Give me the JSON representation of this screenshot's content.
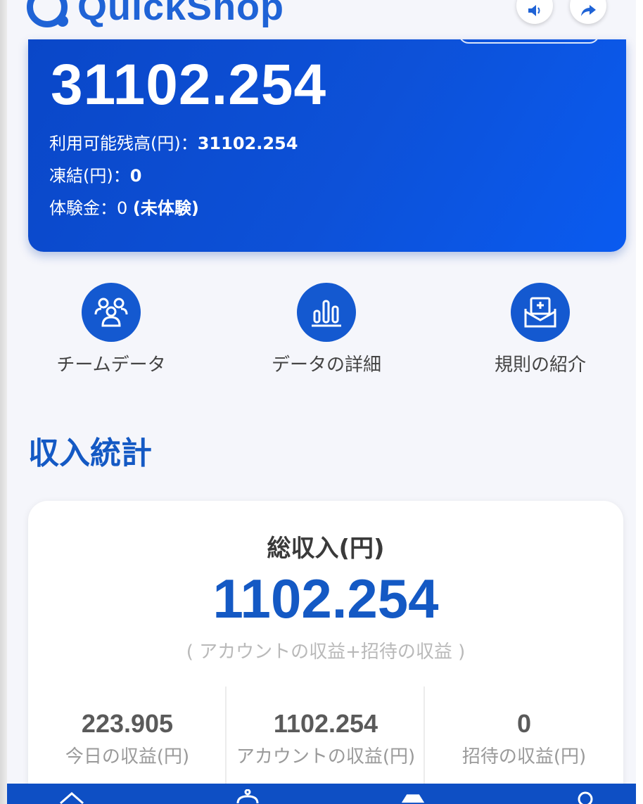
{
  "header": {
    "logo_text": "QuickShop",
    "sound_icon": "speaker-icon",
    "share_icon": "share-icon"
  },
  "balance": {
    "amount": "31102.254",
    "available_label": "利用可能残高(円)：",
    "available_value": "31102.254",
    "frozen_label": "凍結(円)：",
    "frozen_value": "0",
    "trial_label": "体験金：0 ",
    "trial_value": "(未体験)"
  },
  "actions": [
    {
      "label": "チームデータ",
      "icon": "team-icon"
    },
    {
      "label": "データの詳細",
      "icon": "bar-chart-icon"
    },
    {
      "label": "規則の紹介",
      "icon": "rules-envelope-icon"
    }
  ],
  "income": {
    "section_title": "収入統計",
    "total_label": "総収入(円)",
    "total_value": "1102.254",
    "total_note": "( アカウントの収益+招待の収益 )",
    "stats": [
      {
        "value": "223.905",
        "caption": "今日の収益(円)"
      },
      {
        "value": "1102.254",
        "caption": "アカウントの収益(円)"
      },
      {
        "value": "0",
        "caption": "招待の収益(円)"
      }
    ]
  },
  "bottom_nav": {
    "icons": [
      "home-icon",
      "team-nav-icon",
      "center-nav-icon",
      "search-nav-icon"
    ]
  },
  "colors": {
    "brand_blue": "#1459c4",
    "card_blue": "#0a47c8",
    "nav_blue": "#0e4fc4",
    "background": "#f5f6fb"
  }
}
